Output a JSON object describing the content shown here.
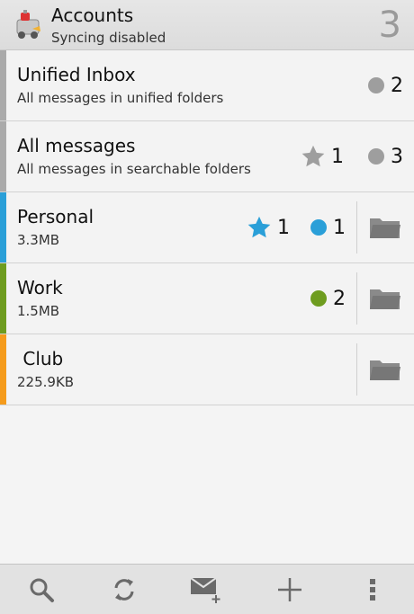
{
  "header": {
    "title": "Accounts",
    "subtitle": "Syncing disabled",
    "count": "3",
    "icon": "k9-robot-app-icon"
  },
  "accounts": [
    {
      "name": "Unified Inbox",
      "description": "All messages in unified folders",
      "color": "#aaaaaa",
      "unread": "2",
      "unread_color": "#9e9e9e"
    },
    {
      "name": "All messages",
      "description": "All messages in searchable folders",
      "color": "#aaaaaa",
      "flagged": "1",
      "flagged_color": "#9e9e9e",
      "unread": "3",
      "unread_color": "#9e9e9e"
    },
    {
      "name": "Personal",
      "description": "3.3MB",
      "color": "#2a9fd8",
      "flagged": "1",
      "flagged_color": "#2a9fd8",
      "unread": "1",
      "unread_color": "#2a9fd8"
    },
    {
      "name": "Work",
      "description": "1.5MB",
      "color": "#6e9c1f",
      "unread": "2",
      "unread_color": "#6e9c1f"
    },
    {
      "name": " Club",
      "description": "225.9KB",
      "color": "#f59b1c"
    }
  ],
  "toolbar": {
    "icons": [
      "search-icon",
      "refresh-icon",
      "compose-icon",
      "add-icon",
      "overflow-menu-icon"
    ]
  }
}
